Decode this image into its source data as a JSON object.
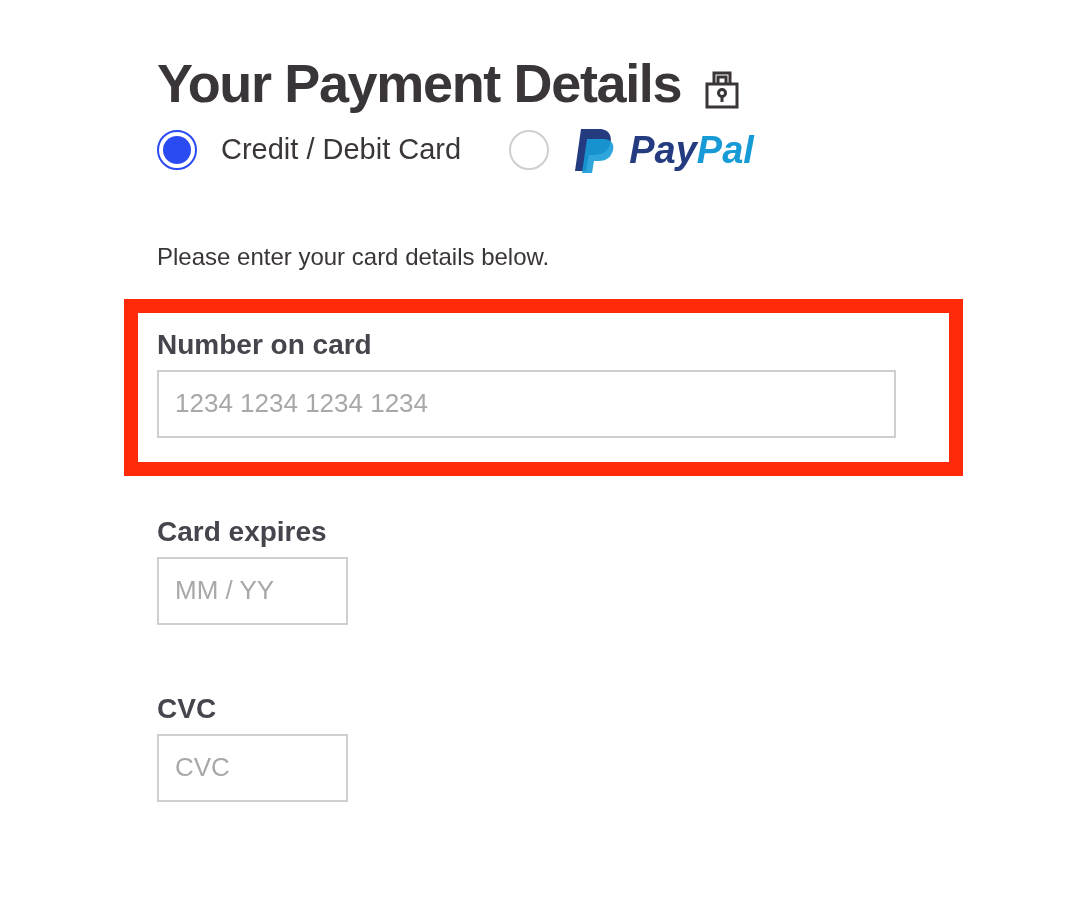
{
  "title": "Your Payment Details",
  "payment_methods": [
    {
      "kind": "text",
      "label": "Credit / Debit Card",
      "selected": true
    },
    {
      "kind": "paypal",
      "label_parts": [
        "Pay",
        "Pal"
      ],
      "selected": false
    }
  ],
  "instructions": "Please enter your card details below.",
  "fields": [
    {
      "label": "Number on card",
      "placeholder": "1234 1234 1234 1234",
      "kind": "wide",
      "highlighted": true
    },
    {
      "label": "Card expires",
      "placeholder": "MM / YY",
      "kind": "narrow",
      "highlighted": false
    },
    {
      "label": "CVC",
      "placeholder": "CVC",
      "kind": "narrow",
      "highlighted": false
    }
  ]
}
